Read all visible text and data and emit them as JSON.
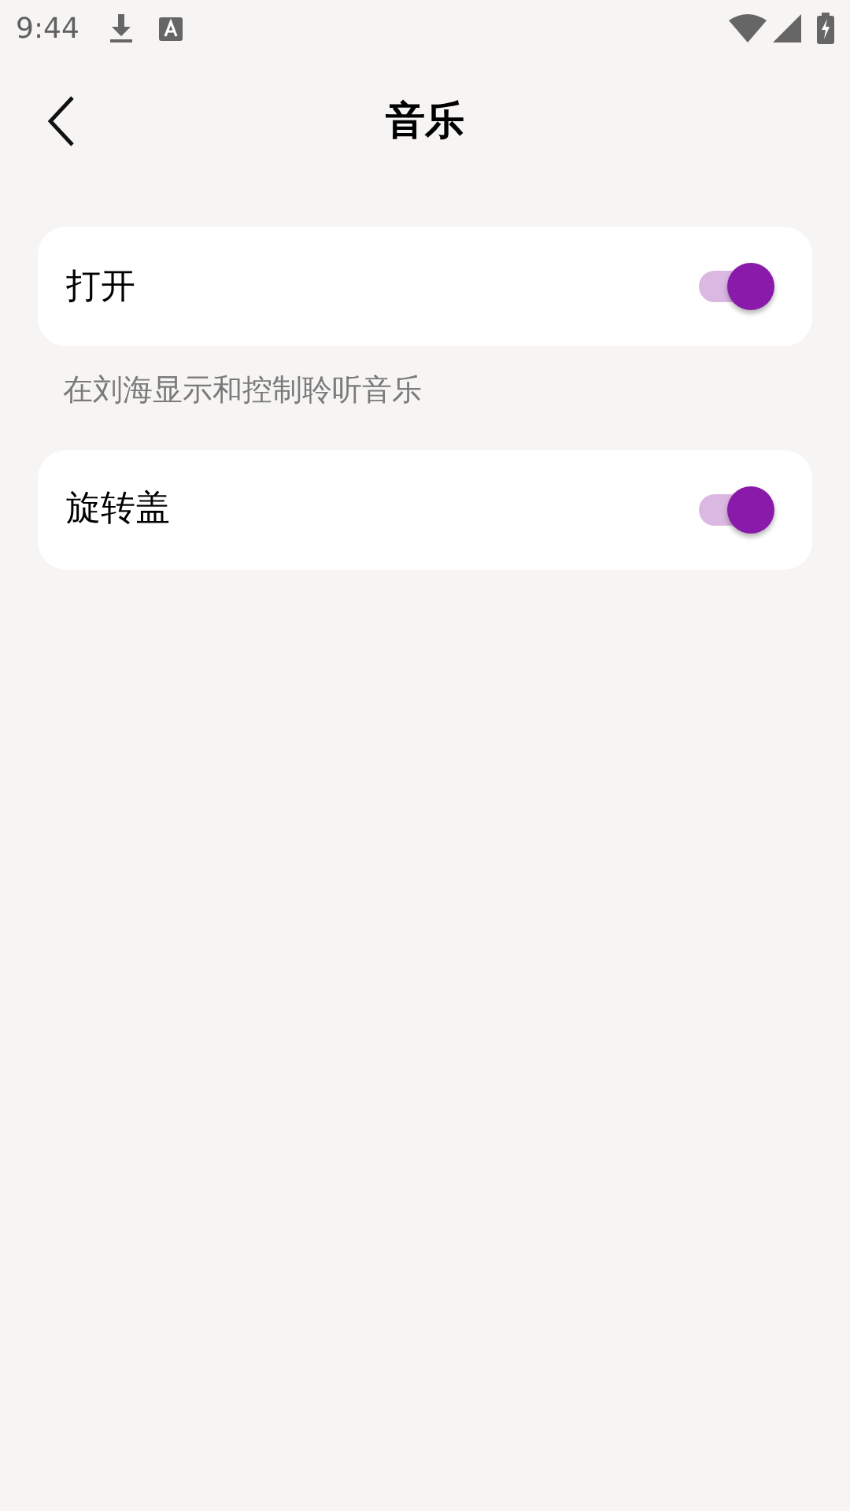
{
  "status_bar": {
    "time": "9:44"
  },
  "header": {
    "title": "音乐"
  },
  "settings": [
    {
      "label": "打开",
      "on": true,
      "description": "在刘海显示和控制聆听音乐"
    },
    {
      "label": "旋转盖",
      "on": true
    }
  ]
}
